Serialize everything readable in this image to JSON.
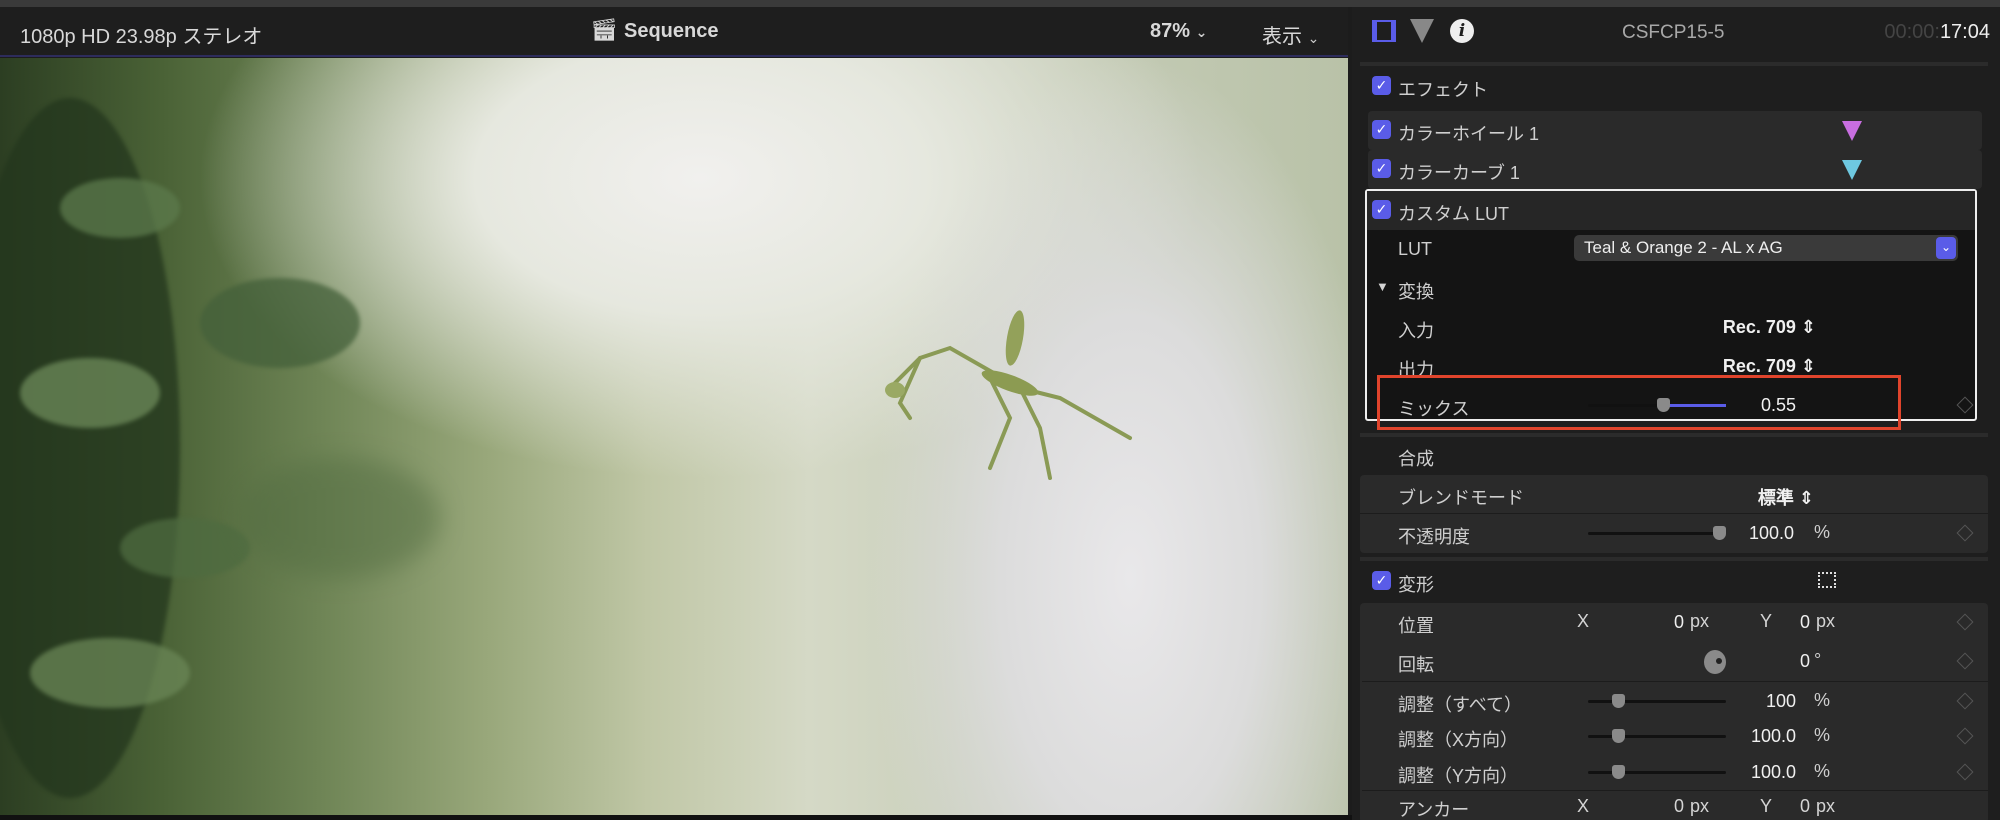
{
  "viewer": {
    "format": "1080p HD 23.98p ステレオ",
    "sequence_icon": "clapperboard-icon",
    "sequence": "Sequence",
    "zoom": "87%",
    "view_menu": "表示"
  },
  "inspector": {
    "header": {
      "icons": [
        "film-icon",
        "color-triangle-icon",
        "info-icon"
      ],
      "clip_name": "CSFCP15-5",
      "timecode_dim": "00:00:",
      "timecode": "17:04"
    },
    "effects": {
      "label": "エフェクト",
      "items": [
        {
          "label": "カラーホイール 1"
        },
        {
          "label": "カラーカーブ 1"
        },
        {
          "label": "カスタム LUT"
        }
      ]
    },
    "lut": {
      "label": "LUT",
      "value": "Teal & Orange 2 - AL x AG"
    },
    "convert": {
      "label": "変換",
      "input_label": "入力",
      "input_value": "Rec. 709",
      "output_label": "出力",
      "output_value": "Rec. 709"
    },
    "mix": {
      "label": "ミックス",
      "value": "0.55",
      "fraction": 0.55
    },
    "composite": {
      "label": "合成",
      "blend_label": "ブレンドモード",
      "blend_value": "標準",
      "opacity_label": "不透明度",
      "opacity_value": "100.0",
      "opacity_unit": "%",
      "opacity_fraction": 1.0
    },
    "transform": {
      "label": "変形",
      "position": {
        "label": "位置",
        "x_label": "X",
        "x": "0",
        "x_unit": "px",
        "y_label": "Y",
        "y": "0",
        "y_unit": "px"
      },
      "rotation": {
        "label": "回転",
        "value": "0",
        "unit": "°"
      },
      "scale_all": {
        "label": "調整（すべて）",
        "value": "100",
        "unit": "%"
      },
      "scale_x": {
        "label": "調整（X方向）",
        "value": "100.0",
        "unit": "%"
      },
      "scale_y": {
        "label": "調整（Y方向）",
        "value": "100.0",
        "unit": "%"
      },
      "anchor": {
        "label": "アンカー",
        "x_label": "X",
        "x": "0",
        "x_unit": "px",
        "y_label": "Y",
        "y": "0",
        "y_unit": "px"
      }
    }
  },
  "colors": {
    "accent": "#5a5ce8",
    "highlight_box": "#e0442c"
  }
}
